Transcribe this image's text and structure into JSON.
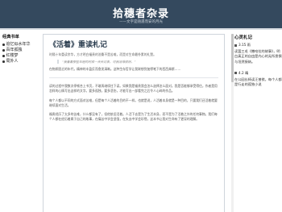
{
  "header": {
    "title": "拾穗者杂录",
    "tagline": "——文字是随遇而安的月光"
  },
  "left_sidebar": {
    "title": "经典书单",
    "items": [
      {
        "label": "追忆似水年华"
      },
      {
        "label": "百年孤独"
      },
      {
        "label": "红楼梦"
      },
      {
        "label": "局外人"
      }
    ]
  },
  "article": {
    "title": "《活着》重读札记",
    "meta": "时隔十年重读余华，方才明白福贵的沧桑不是苦难，而是对生命最朴素的礼赞。",
    "quote": "“我看着那些年轻的时候一天天过去，可我活得很好。”",
    "paragraphs": [
      "在物质匮乏的年代，精神的丰盈反而愈发清晰。这种生存哲学让我联想到加缪笔下的西西弗斯……",
      "读的过程中我数次停顿合上书页，不敢再继续往下读。如果我是福贵我会怎么选择怎么面对。我是否能够承受得住。作者是用怎样的心情写出这样的文字。要多孤独，要多悲伤，才能写出一部看完之后令人心碎的作品。",
      "每个人都以不同的方式面对苦难，但是每个人活着的目的不一样。也就是说，人活着本身就是一种目的，只要我们还活着就要继续面对生活。",
      "福贵经历了太多的苦难，什么都没有了，但他依旧活着。人活下去是为了生活本身，而不是为了活着之外的任何事物。我们每个人都在经历着属于自己的故事，在痛苦中学会坚强，在失去中学会珍惜，这本书让我对生命有了更深的理解。"
    ]
  },
  "right_sidebar": {
    "title": "心灵札记",
    "blocks": [
      {
        "date": "3.15 雨",
        "text": "读罢三毛《撒哈拉的故事》，明白真正的自由是内心的无所畏惧与坦然接纳。"
      },
      {
        "date": "4.2 晴",
        "text": "在公园长椅读汪曾祺，每个人都是行走的孤独小说"
      }
    ]
  },
  "colors": {
    "header_bg": "#34495e",
    "title_color": "#2c3e50"
  }
}
